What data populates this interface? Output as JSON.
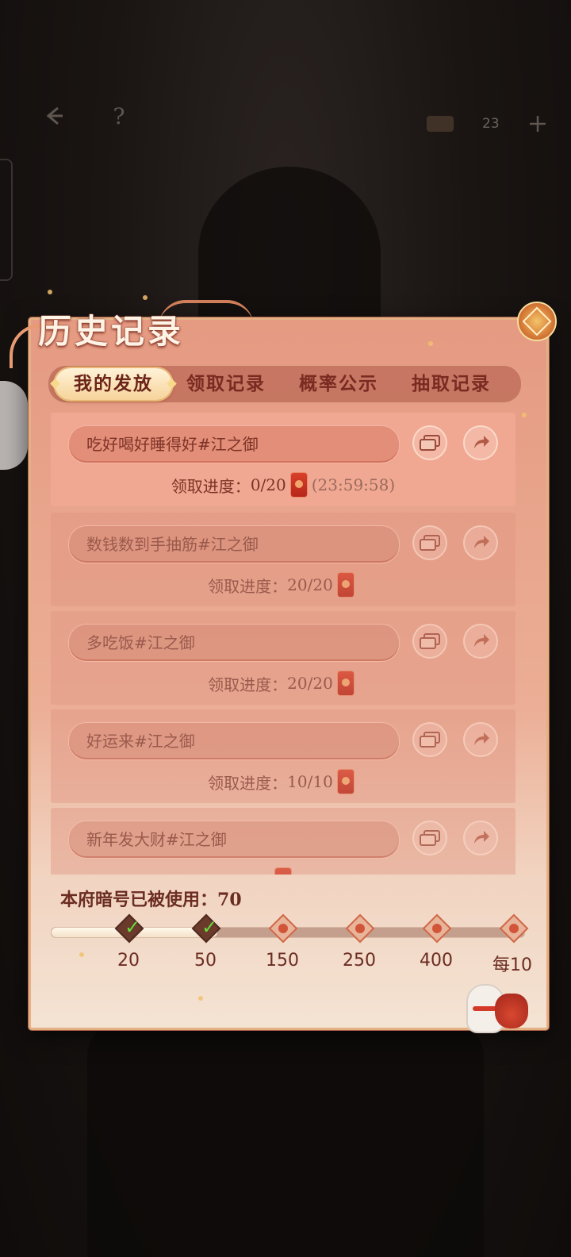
{
  "top_bar": {
    "back_icon": "back-arrow-icon",
    "help_icon": "question-mark-icon",
    "currency_icon": "ingot-icon",
    "currency_count": "23",
    "add_icon": "plus-icon"
  },
  "panel": {
    "title": "历史记录",
    "tabs": [
      {
        "label": "我的发放",
        "active": true
      },
      {
        "label": "领取记录",
        "active": false
      },
      {
        "label": "概率公示",
        "active": false
      },
      {
        "label": "抽取记录",
        "active": false
      }
    ],
    "records": [
      {
        "name": "吃好喝好睡得好#江之御",
        "progress_label": "领取进度：",
        "progress": "0/20",
        "timer": "(23:59:58)"
      },
      {
        "name": "数钱数到手抽筋#江之御",
        "progress_label": "领取进度：",
        "progress": "20/20"
      },
      {
        "name": "多吃饭#江之御",
        "progress_label": "领取进度：",
        "progress": "20/20"
      },
      {
        "name": "好运来#江之御",
        "progress_label": "领取进度：",
        "progress": "10/10"
      },
      {
        "name": "新年发大财#江之御"
      }
    ],
    "usage": {
      "label": "本府暗号已被使用：",
      "count": "70",
      "progress_fraction": 0.35,
      "milestones": [
        {
          "label": "20",
          "done": true
        },
        {
          "label": "50",
          "done": true
        },
        {
          "label": "150",
          "done": false
        },
        {
          "label": "250",
          "done": false
        },
        {
          "label": "400",
          "done": false
        },
        {
          "label": "每10",
          "done": false
        }
      ]
    }
  },
  "colors": {
    "panel_top": "#e59a82",
    "panel_bottom": "#f4e3d3",
    "text_dark": "#7e3326",
    "envelope_red": "#c8311f",
    "check_green": "#66dd3c"
  }
}
